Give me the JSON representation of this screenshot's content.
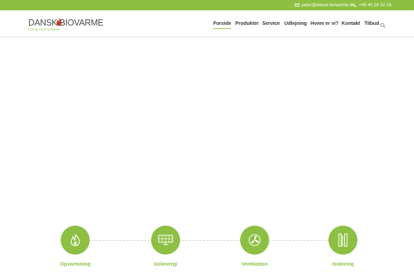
{
  "topbar": {
    "email": "peter@dansk-biovarme.dk",
    "phone": "+45 40 26 32 16",
    "email_icon": "envelope-icon",
    "phone_icon": "phone-icon"
  },
  "logo": {
    "wordmark": "DANSK BIOVARME",
    "tagline": "Energi med omtanke"
  },
  "nav": {
    "items": [
      {
        "label": "Forside",
        "active": true
      },
      {
        "label": "Produkter",
        "active": false
      },
      {
        "label": "Service",
        "active": false
      },
      {
        "label": "Udlejning",
        "active": false
      },
      {
        "label": "Hvem er vi?",
        "active": false
      },
      {
        "label": "Kontakt",
        "active": false
      },
      {
        "label": "Tilbud",
        "active": false
      }
    ],
    "search_icon": "search-icon"
  },
  "features": [
    {
      "label": "Opvarmning",
      "icon": "flame-icon"
    },
    {
      "label": "Solenergi",
      "icon": "solar-panel-icon"
    },
    {
      "label": "Ventilation",
      "icon": "fan-icon"
    },
    {
      "label": "Isolering",
      "icon": "insulation-icon"
    }
  ],
  "colors": {
    "accent": "#8dbf42",
    "nav_text": "#333333",
    "logo_text": "#4a4a4a",
    "flame": "#c0392b"
  }
}
